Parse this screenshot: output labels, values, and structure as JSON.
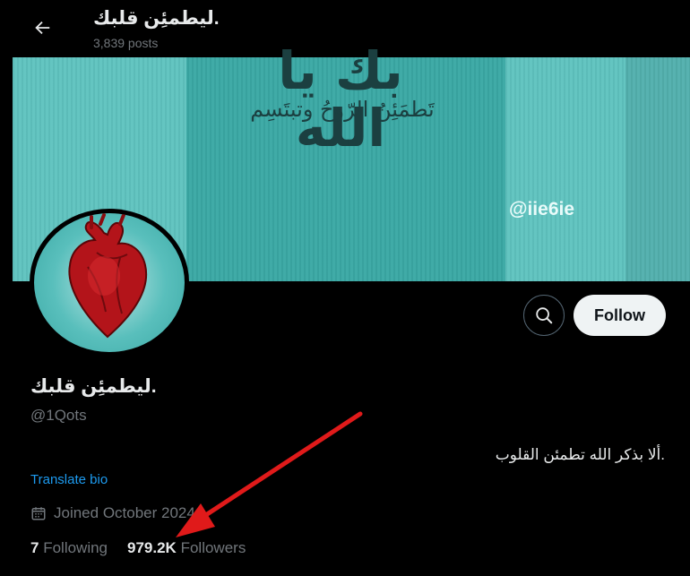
{
  "header": {
    "title": ".ليطمئِن قلبك",
    "posts_count": "3,839 posts"
  },
  "banner": {
    "big_text": "بك يا الله",
    "small_text": "تَطمَئِنُ الرّوحُ وتبتَسِم",
    "watermark": "@iie6ie"
  },
  "actions": {
    "follow_label": "Follow"
  },
  "profile": {
    "name": ".ليطمئِن قلبك",
    "handle": "@1Qots",
    "bio": ".ألا بذكر الله تطمئن القلوب",
    "translate_label": "Translate bio",
    "joined": "Joined October 2024",
    "following_count": "7",
    "following_label": "Following",
    "followers_count": "979.2K",
    "followers_label": "Followers"
  },
  "colors": {
    "accent_link": "#1d9bf0",
    "annotation_arrow": "#e01a1a",
    "banner_teal": "#3aa8a4"
  },
  "icons": [
    "back-arrow-icon",
    "search-icon",
    "calendar-icon"
  ]
}
